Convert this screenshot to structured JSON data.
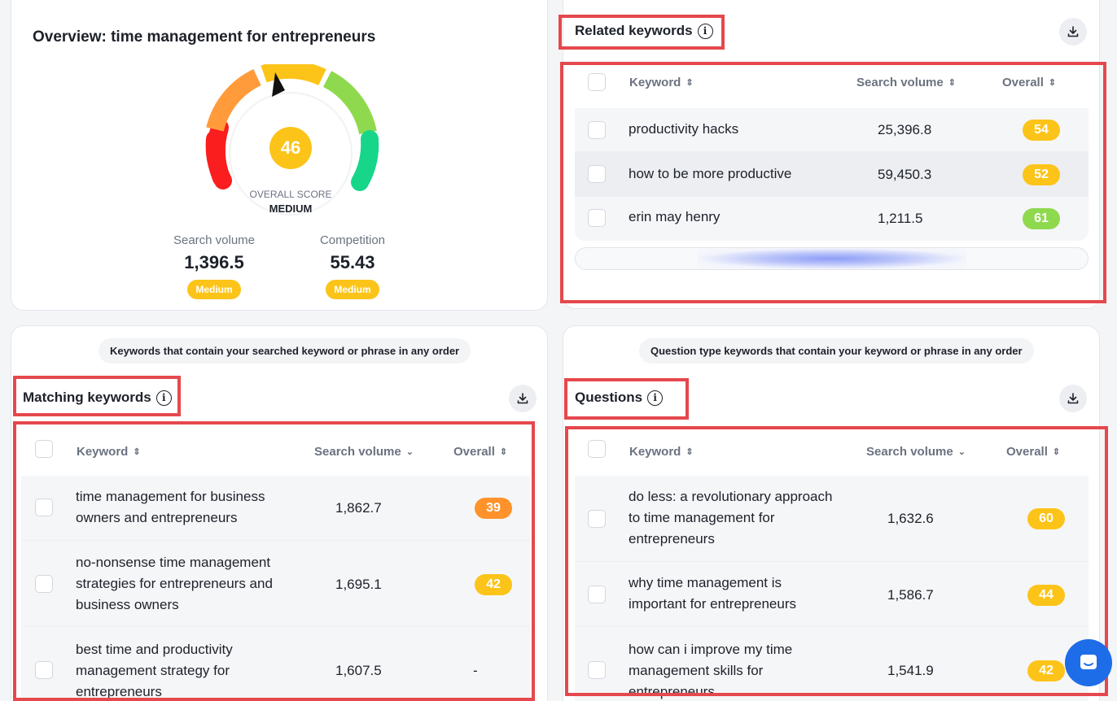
{
  "overview": {
    "title": "Overview: time management for entrepreneurs",
    "score": "46",
    "score_caption": "OVERALL SCORE",
    "score_level": "MEDIUM",
    "search_volume_label": "Search volume",
    "search_volume_value": "1,396.5",
    "search_volume_badge": "Medium",
    "competition_label": "Competition",
    "competition_value": "55.43",
    "competition_badge": "Medium"
  },
  "related": {
    "title": "Related keywords",
    "col_keyword": "Keyword",
    "col_volume": "Search volume",
    "col_overall": "Overall",
    "rows": [
      {
        "keyword": "productivity hacks",
        "volume": "25,396.8",
        "score": "54",
        "color": "#fcc419"
      },
      {
        "keyword": "how to be more productive",
        "volume": "59,450.3",
        "score": "52",
        "color": "#fcc419"
      },
      {
        "keyword": "erin may henry",
        "volume": "1,211.5",
        "score": "61",
        "color": "#8fd94e"
      }
    ]
  },
  "matching": {
    "note": "Keywords that contain your searched keyword or phrase in any order",
    "title": "Matching keywords",
    "col_keyword": "Keyword",
    "col_volume": "Search volume",
    "col_overall": "Overall",
    "rows": [
      {
        "keyword_l1": "time management for business",
        "keyword_l2": "owners and entrepreneurs",
        "keyword_l3": "",
        "volume": "1,862.7",
        "score": "39",
        "color": "#ff922b"
      },
      {
        "keyword_l1": "no-nonsense time management",
        "keyword_l2": "strategies for entrepreneurs and",
        "keyword_l3": "business owners",
        "volume": "1,695.1",
        "score": "42",
        "color": "#fcc419"
      },
      {
        "keyword_l1": "best time and productivity",
        "keyword_l2": "management strategy for",
        "keyword_l3": "entrepreneurs",
        "volume": "1,607.5",
        "score": "-",
        "color": ""
      }
    ]
  },
  "questions": {
    "note": "Question type keywords that contain your keyword or phrase in any order",
    "title": "Questions",
    "col_keyword": "Keyword",
    "col_volume": "Search volume",
    "col_overall": "Overall",
    "rows": [
      {
        "keyword_l1": "do less: a revolutionary approach",
        "keyword_l2": "to time management for",
        "keyword_l3": "entrepreneurs",
        "volume": "1,632.6",
        "score": "60",
        "color": "#fcc419"
      },
      {
        "keyword_l1": "why time management is",
        "keyword_l2": "important for entrepreneurs",
        "keyword_l3": "",
        "volume": "1,586.7",
        "score": "44",
        "color": "#fcc419"
      },
      {
        "keyword_l1": "how can i improve my time",
        "keyword_l2": "management skills for",
        "keyword_l3": "entrepreneurs",
        "volume": "1,541.9",
        "score": "42",
        "color": "#fcc419"
      }
    ]
  },
  "colors": {
    "accent_yellow": "#fcc419",
    "accent_orange": "#ff922b",
    "accent_green": "#8fd94e",
    "highlight_red": "#e5484d"
  }
}
